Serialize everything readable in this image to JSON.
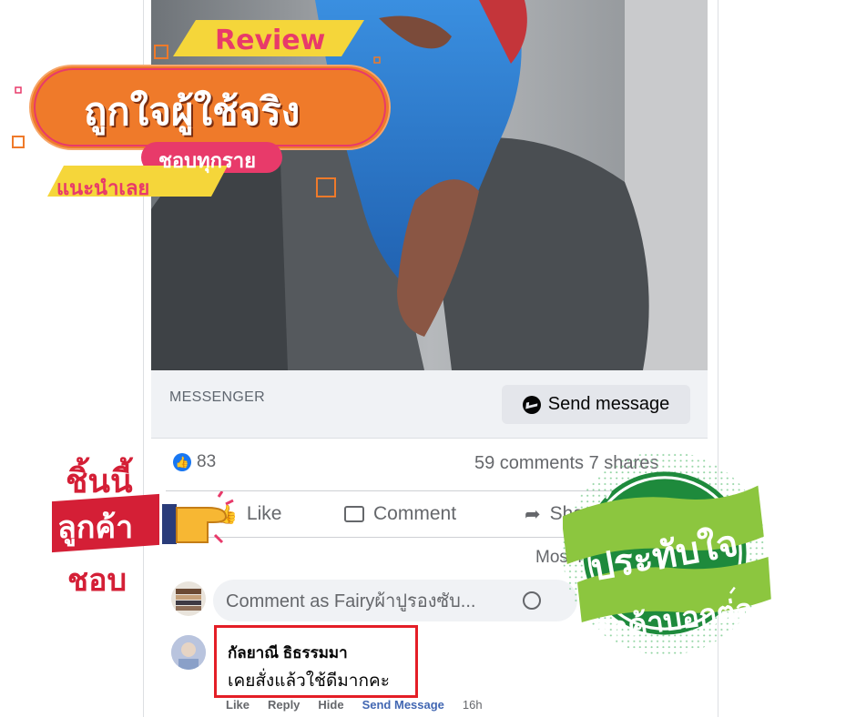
{
  "video": {
    "mute_icon": "speaker-muted-icon"
  },
  "promo": {
    "review_label": "Review",
    "headline": "ถูกใจผู้ใช้จริง",
    "subline": "ชอบทุกราย",
    "recommend": "แนะนำเลย",
    "left_tag": {
      "line1": "ชิ้นนี้",
      "line2": "ลูกค้า",
      "line3": "ชอบ"
    },
    "badge": {
      "line1": "ประทับใจ",
      "line2": "ลูกค้าบอกต่อ"
    },
    "colors": {
      "orange": "#ef7a2a",
      "pink": "#e83a6a",
      "yellow": "#f5d63a",
      "green": "#4bb04a",
      "green_dark": "#1e8a3c",
      "red": "#d41f36"
    }
  },
  "messenger": {
    "label": "MESSENGER",
    "button_label": "Send message"
  },
  "stats": {
    "like_count": "83",
    "comments_shares": "59 comments  7 shares"
  },
  "actions": {
    "like": "Like",
    "comment": "Comment",
    "share": "Share"
  },
  "sort_label": "Most relevant",
  "composer": {
    "placeholder": "Comment as Fairyผ้าปูรองซับ..."
  },
  "comment": {
    "author": "กัลยาณี ธิธรรมมา",
    "text": "เคยสั่งแล้วใช้ดีมากคะ",
    "like": "Like",
    "reply": "Reply",
    "hide": "Hide",
    "send_message": "Send Message",
    "time": "16h"
  }
}
